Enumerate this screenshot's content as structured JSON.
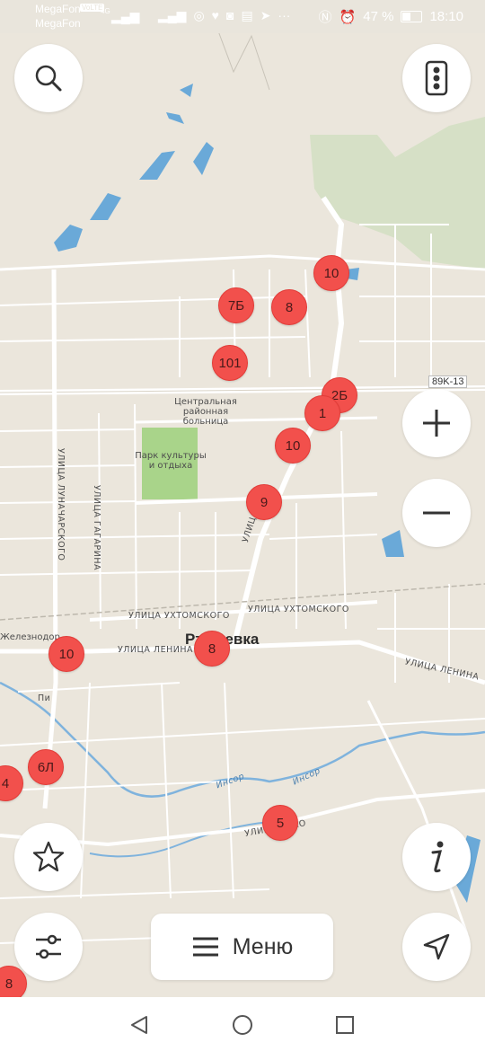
{
  "status_bar": {
    "operator_primary": "MegaFon",
    "operator_badge": "VoLTE",
    "operator_secondary": "MegaFon",
    "network_type": "4G",
    "battery": "47 %",
    "time": "18:10"
  },
  "map": {
    "road_number": "89K-13",
    "town_name": "Ртищевка",
    "labels": {
      "hospital": "Центральная районная больница",
      "park": "Парк культуры и отдыха",
      "lunacharskogo": "УЛИЦА ЛУНАЧАРСКОГО",
      "gagarina": "УЛИЦА ГАГАРИНА",
      "ukhtomskogo_1": "УЛИЦА УХТОМСКОГО",
      "ukhtomskogo_2": "УЛИЦА УХТОМСКОГО",
      "lenina_1": "УЛИЦА ЛЕНИНА",
      "lenina_2": "УЛИЦА ЛЕНИНА",
      "zheleznodor": "Железнодор",
      "insor_1": "Инсор",
      "insor_2": "Инсор",
      "street_ulitsa_ma": "УЛИЦА МА",
      "street_enko": "УЛИЦА  ЕНКО",
      "stream_short": "Пи"
    },
    "markers": [
      {
        "id": "m10a",
        "label": "10"
      },
      {
        "id": "m7b",
        "label": "7Б"
      },
      {
        "id": "m8a",
        "label": "8"
      },
      {
        "id": "m101",
        "label": "101"
      },
      {
        "id": "m25",
        "label": "2Б"
      },
      {
        "id": "m1",
        "label": "1"
      },
      {
        "id": "m10b",
        "label": "10"
      },
      {
        "id": "m9",
        "label": "9"
      },
      {
        "id": "m10c",
        "label": "10"
      },
      {
        "id": "m8b",
        "label": "8"
      },
      {
        "id": "m6l",
        "label": "6Л"
      },
      {
        "id": "m4",
        "label": "4"
      },
      {
        "id": "m5",
        "label": "5"
      },
      {
        "id": "m8c",
        "label": "8"
      }
    ]
  },
  "controls": {
    "search_icon": "search-icon",
    "traffic_icon": "traffic-light-icon",
    "zoom_in_icon": "plus-icon",
    "zoom_out_icon": "minus-icon",
    "favorites_icon": "star-icon",
    "info_icon": "info-icon",
    "settings_icon": "sliders-icon",
    "locate_icon": "navigation-arrow-icon",
    "menu_label": "Меню"
  },
  "navbar": {
    "back_icon": "back-triangle-icon",
    "home_icon": "home-circle-icon",
    "recents_icon": "recents-square-icon"
  },
  "colors": {
    "marker": "#f2504c",
    "water": "#6aa9d8",
    "park": "#a9d48a",
    "map_bg": "#ebe6dc"
  }
}
